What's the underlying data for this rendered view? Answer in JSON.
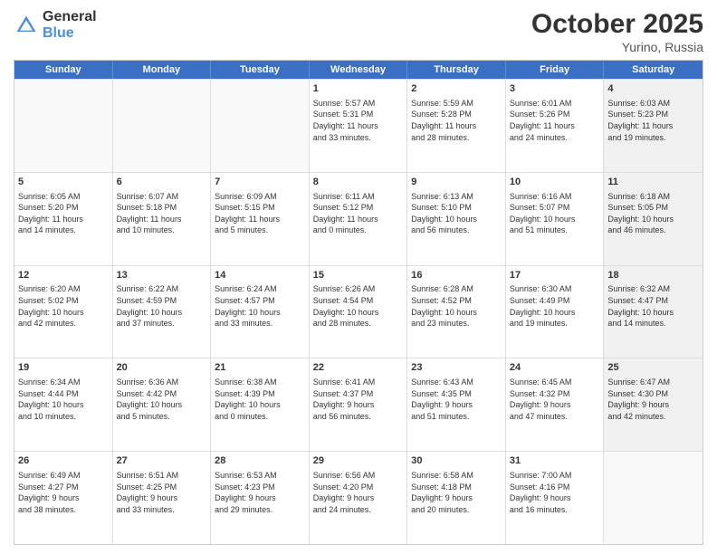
{
  "header": {
    "logo_general": "General",
    "logo_blue": "Blue",
    "month": "October 2025",
    "location": "Yurino, Russia"
  },
  "days_of_week": [
    "Sunday",
    "Monday",
    "Tuesday",
    "Wednesday",
    "Thursday",
    "Friday",
    "Saturday"
  ],
  "rows": [
    [
      {
        "day": "",
        "info": "",
        "shaded": false,
        "empty": true
      },
      {
        "day": "",
        "info": "",
        "shaded": false,
        "empty": true
      },
      {
        "day": "",
        "info": "",
        "shaded": false,
        "empty": true
      },
      {
        "day": "1",
        "info": "Sunrise: 5:57 AM\nSunset: 5:31 PM\nDaylight: 11 hours\nand 33 minutes.",
        "shaded": false,
        "empty": false
      },
      {
        "day": "2",
        "info": "Sunrise: 5:59 AM\nSunset: 5:28 PM\nDaylight: 11 hours\nand 28 minutes.",
        "shaded": false,
        "empty": false
      },
      {
        "day": "3",
        "info": "Sunrise: 6:01 AM\nSunset: 5:26 PM\nDaylight: 11 hours\nand 24 minutes.",
        "shaded": false,
        "empty": false
      },
      {
        "day": "4",
        "info": "Sunrise: 6:03 AM\nSunset: 5:23 PM\nDaylight: 11 hours\nand 19 minutes.",
        "shaded": true,
        "empty": false
      }
    ],
    [
      {
        "day": "5",
        "info": "Sunrise: 6:05 AM\nSunset: 5:20 PM\nDaylight: 11 hours\nand 14 minutes.",
        "shaded": false,
        "empty": false
      },
      {
        "day": "6",
        "info": "Sunrise: 6:07 AM\nSunset: 5:18 PM\nDaylight: 11 hours\nand 10 minutes.",
        "shaded": false,
        "empty": false
      },
      {
        "day": "7",
        "info": "Sunrise: 6:09 AM\nSunset: 5:15 PM\nDaylight: 11 hours\nand 5 minutes.",
        "shaded": false,
        "empty": false
      },
      {
        "day": "8",
        "info": "Sunrise: 6:11 AM\nSunset: 5:12 PM\nDaylight: 11 hours\nand 0 minutes.",
        "shaded": false,
        "empty": false
      },
      {
        "day": "9",
        "info": "Sunrise: 6:13 AM\nSunset: 5:10 PM\nDaylight: 10 hours\nand 56 minutes.",
        "shaded": false,
        "empty": false
      },
      {
        "day": "10",
        "info": "Sunrise: 6:16 AM\nSunset: 5:07 PM\nDaylight: 10 hours\nand 51 minutes.",
        "shaded": false,
        "empty": false
      },
      {
        "day": "11",
        "info": "Sunrise: 6:18 AM\nSunset: 5:05 PM\nDaylight: 10 hours\nand 46 minutes.",
        "shaded": true,
        "empty": false
      }
    ],
    [
      {
        "day": "12",
        "info": "Sunrise: 6:20 AM\nSunset: 5:02 PM\nDaylight: 10 hours\nand 42 minutes.",
        "shaded": false,
        "empty": false
      },
      {
        "day": "13",
        "info": "Sunrise: 6:22 AM\nSunset: 4:59 PM\nDaylight: 10 hours\nand 37 minutes.",
        "shaded": false,
        "empty": false
      },
      {
        "day": "14",
        "info": "Sunrise: 6:24 AM\nSunset: 4:57 PM\nDaylight: 10 hours\nand 33 minutes.",
        "shaded": false,
        "empty": false
      },
      {
        "day": "15",
        "info": "Sunrise: 6:26 AM\nSunset: 4:54 PM\nDaylight: 10 hours\nand 28 minutes.",
        "shaded": false,
        "empty": false
      },
      {
        "day": "16",
        "info": "Sunrise: 6:28 AM\nSunset: 4:52 PM\nDaylight: 10 hours\nand 23 minutes.",
        "shaded": false,
        "empty": false
      },
      {
        "day": "17",
        "info": "Sunrise: 6:30 AM\nSunset: 4:49 PM\nDaylight: 10 hours\nand 19 minutes.",
        "shaded": false,
        "empty": false
      },
      {
        "day": "18",
        "info": "Sunrise: 6:32 AM\nSunset: 4:47 PM\nDaylight: 10 hours\nand 14 minutes.",
        "shaded": true,
        "empty": false
      }
    ],
    [
      {
        "day": "19",
        "info": "Sunrise: 6:34 AM\nSunset: 4:44 PM\nDaylight: 10 hours\nand 10 minutes.",
        "shaded": false,
        "empty": false
      },
      {
        "day": "20",
        "info": "Sunrise: 6:36 AM\nSunset: 4:42 PM\nDaylight: 10 hours\nand 5 minutes.",
        "shaded": false,
        "empty": false
      },
      {
        "day": "21",
        "info": "Sunrise: 6:38 AM\nSunset: 4:39 PM\nDaylight: 10 hours\nand 0 minutes.",
        "shaded": false,
        "empty": false
      },
      {
        "day": "22",
        "info": "Sunrise: 6:41 AM\nSunset: 4:37 PM\nDaylight: 9 hours\nand 56 minutes.",
        "shaded": false,
        "empty": false
      },
      {
        "day": "23",
        "info": "Sunrise: 6:43 AM\nSunset: 4:35 PM\nDaylight: 9 hours\nand 51 minutes.",
        "shaded": false,
        "empty": false
      },
      {
        "day": "24",
        "info": "Sunrise: 6:45 AM\nSunset: 4:32 PM\nDaylight: 9 hours\nand 47 minutes.",
        "shaded": false,
        "empty": false
      },
      {
        "day": "25",
        "info": "Sunrise: 6:47 AM\nSunset: 4:30 PM\nDaylight: 9 hours\nand 42 minutes.",
        "shaded": true,
        "empty": false
      }
    ],
    [
      {
        "day": "26",
        "info": "Sunrise: 6:49 AM\nSunset: 4:27 PM\nDaylight: 9 hours\nand 38 minutes.",
        "shaded": false,
        "empty": false
      },
      {
        "day": "27",
        "info": "Sunrise: 6:51 AM\nSunset: 4:25 PM\nDaylight: 9 hours\nand 33 minutes.",
        "shaded": false,
        "empty": false
      },
      {
        "day": "28",
        "info": "Sunrise: 6:53 AM\nSunset: 4:23 PM\nDaylight: 9 hours\nand 29 minutes.",
        "shaded": false,
        "empty": false
      },
      {
        "day": "29",
        "info": "Sunrise: 6:56 AM\nSunset: 4:20 PM\nDaylight: 9 hours\nand 24 minutes.",
        "shaded": false,
        "empty": false
      },
      {
        "day": "30",
        "info": "Sunrise: 6:58 AM\nSunset: 4:18 PM\nDaylight: 9 hours\nand 20 minutes.",
        "shaded": false,
        "empty": false
      },
      {
        "day": "31",
        "info": "Sunrise: 7:00 AM\nSunset: 4:16 PM\nDaylight: 9 hours\nand 16 minutes.",
        "shaded": false,
        "empty": false
      },
      {
        "day": "",
        "info": "",
        "shaded": true,
        "empty": true
      }
    ]
  ]
}
